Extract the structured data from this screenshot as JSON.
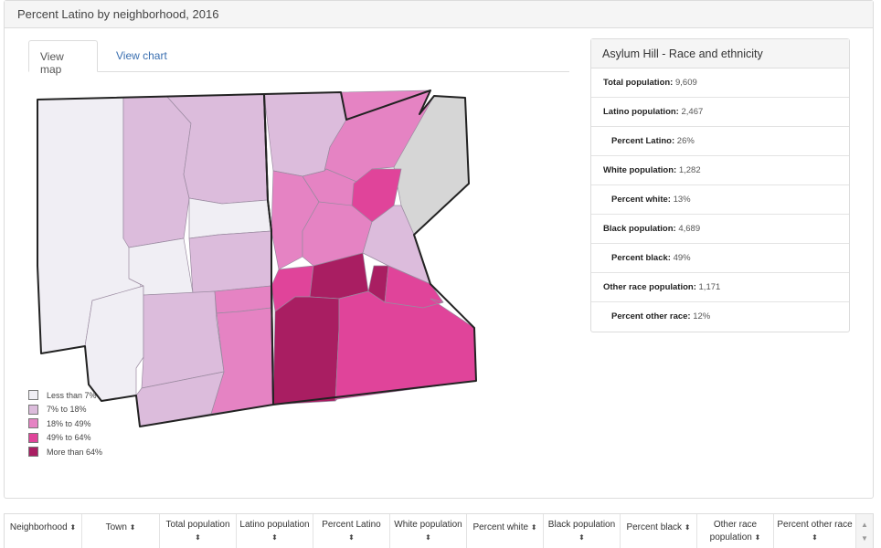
{
  "header": {
    "title": "Percent Latino by neighborhood, 2016"
  },
  "tabs": [
    {
      "label": "View map"
    },
    {
      "label": "View chart"
    }
  ],
  "legend": [
    {
      "label": "Less than 7%",
      "color": "#f0eef4"
    },
    {
      "label": "7% to 18%",
      "color": "#dcbcdc"
    },
    {
      "label": "18% to 49%",
      "color": "#e583c3"
    },
    {
      "label": "49% to 64%",
      "color": "#e0449a"
    },
    {
      "label": "More than 64%",
      "color": "#a91e62"
    }
  ],
  "info": {
    "title": "Asylum Hill - Race and ethnicity",
    "rows": [
      {
        "label": "Total population:",
        "value": "9,609"
      },
      {
        "label": "Latino population:",
        "value": "2,467"
      },
      {
        "label": "Percent Latino:",
        "value": "26%"
      },
      {
        "label": "White population:",
        "value": "1,282"
      },
      {
        "label": "Percent white:",
        "value": "13%"
      },
      {
        "label": "Black population:",
        "value": "4,689"
      },
      {
        "label": "Percent black:",
        "value": "49%"
      },
      {
        "label": "Other race population:",
        "value": "1,171"
      },
      {
        "label": "Percent other race:",
        "value": "12%"
      }
    ]
  },
  "table": {
    "columns": [
      {
        "label": "Neighborhood",
        "sort": "⬍"
      },
      {
        "label": "Town",
        "sort": "⬍"
      },
      {
        "label": "Total population",
        "sort": "⬍"
      },
      {
        "label": "Latino population",
        "sort": "⬍"
      },
      {
        "label": "Percent Latino",
        "sort": "⬍"
      },
      {
        "label": "White population",
        "sort": "⬍"
      },
      {
        "label": "Percent white",
        "sort": "⬍"
      },
      {
        "label": "Black population",
        "sort": "⬍"
      },
      {
        "label": "Percent black",
        "sort": "⬍"
      },
      {
        "label": "Other race population",
        "sort": "⬍"
      },
      {
        "label": "Percent other race",
        "sort": "⬍"
      }
    ],
    "scroll_up": "▲",
    "scroll_down": "▼"
  }
}
